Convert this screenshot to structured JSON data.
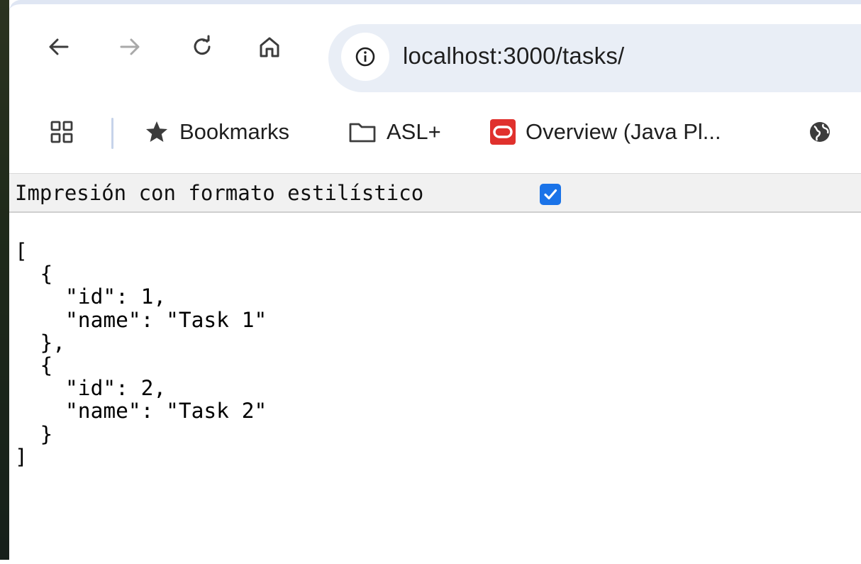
{
  "browser": {
    "address_bar": {
      "url": "localhost:3000/tasks/"
    },
    "bookmarks": [
      {
        "label": "Bookmarks",
        "icon": "star-icon"
      },
      {
        "label": "ASL+",
        "icon": "folder-icon"
      },
      {
        "label": "Overview (Java Pl...",
        "icon": "oracle-icon"
      }
    ],
    "accent_color": "#1a73e8"
  },
  "page": {
    "pretty_print_label": "Impresión con formato estilístico",
    "pretty_print_checked": true,
    "json_text": "[\n  {\n    \"id\": 1,\n    \"name\": \"Task 1\"\n  },\n  {\n    \"id\": 2,\n    \"name\": \"Task 2\"\n  }\n]"
  }
}
